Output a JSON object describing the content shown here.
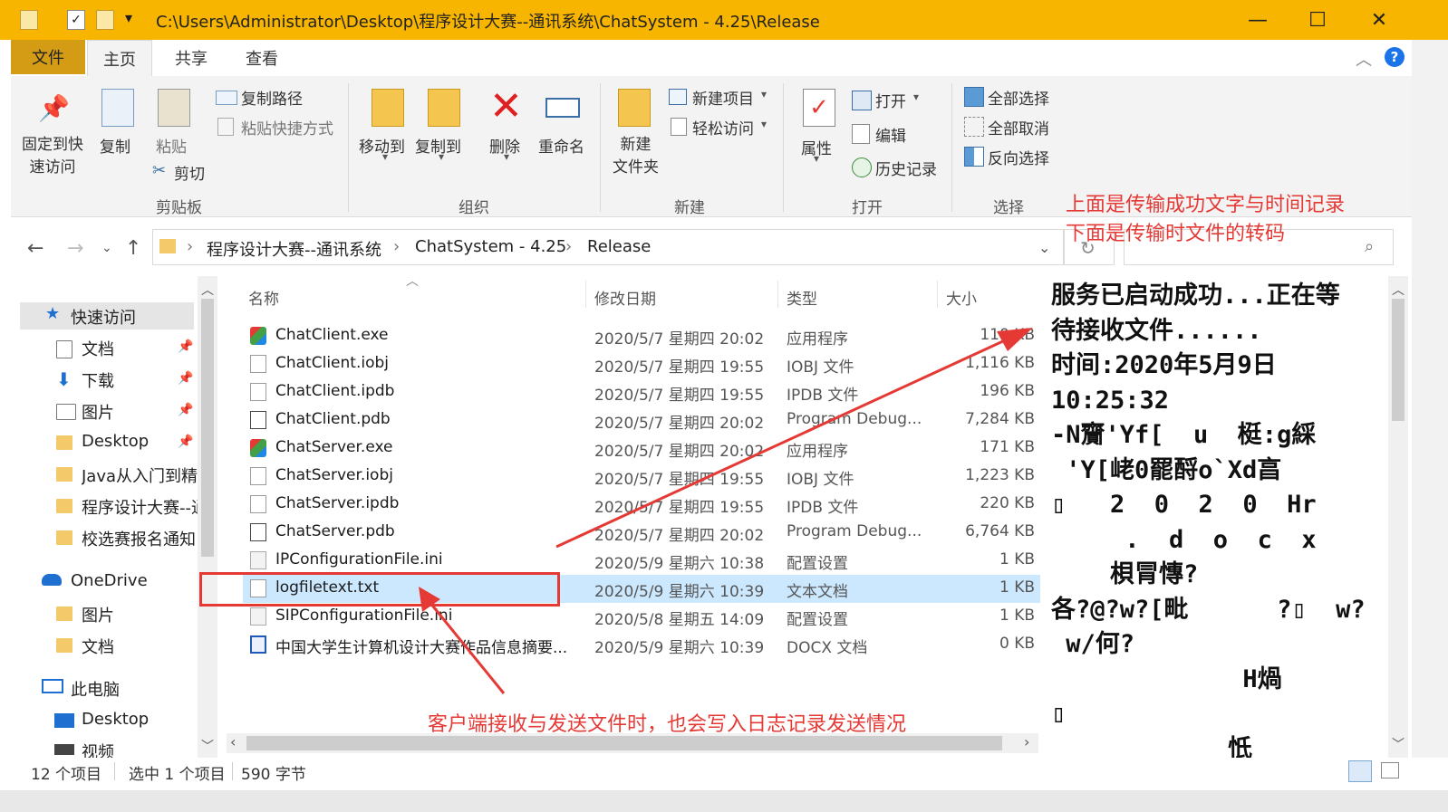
{
  "window": {
    "title": "C:\\Users\\Administrator\\Desktop\\程序设计大赛--通讯系统\\ChatSystem - 4.25\\Release",
    "controls": {
      "minimize": "—",
      "maximize": "☐",
      "close": "✕"
    }
  },
  "tabs": {
    "file": "文件",
    "home": "主页",
    "share": "共享",
    "view": "查看"
  },
  "ribbon": {
    "clipboard": {
      "pin": "固定到快\n速访问",
      "copy": "复制",
      "paste": "粘贴",
      "copy_path": "复制路径",
      "paste_shortcut": "粘贴快捷方式",
      "cut": "剪切",
      "group": "剪贴板"
    },
    "organize": {
      "move_to": "移动到",
      "copy_to": "复制到",
      "delete": "删除",
      "rename": "重命名",
      "group": "组织"
    },
    "new": {
      "new_folder": "新建\n文件夹",
      "new_item": "新建项目",
      "easy_access": "轻松访问",
      "group": "新建"
    },
    "open": {
      "properties": "属性",
      "open": "打开",
      "edit": "编辑",
      "history": "历史记录",
      "group": "打开"
    },
    "select": {
      "select_all": "全部选择",
      "select_none": "全部取消",
      "invert": "反向选择",
      "group": "选择"
    }
  },
  "address": {
    "crumbs": [
      "程序设计大赛--通讯系统",
      "ChatSystem - 4.25",
      "Release"
    ]
  },
  "navpane": {
    "quick_access": "快速访问",
    "items": [
      {
        "label": "文档",
        "pinned": true
      },
      {
        "label": "下载",
        "pinned": true
      },
      {
        "label": "图片",
        "pinned": true
      },
      {
        "label": "Desktop",
        "pinned": true
      },
      {
        "label": "Java从入门到精",
        "pinned": false
      },
      {
        "label": "程序设计大赛--通",
        "pinned": false
      },
      {
        "label": "校选赛报名通知",
        "pinned": false
      }
    ],
    "onedrive": "OneDrive",
    "onedrive_items": [
      "图片",
      "文档"
    ],
    "thispc": "此电脑",
    "thispc_items": [
      "Desktop",
      "视频"
    ]
  },
  "columns": {
    "name": "名称",
    "date": "修改日期",
    "type": "类型",
    "size": "大小"
  },
  "files": [
    {
      "name": "ChatClient.exe",
      "date": "2020/5/7 星期四 20:02",
      "type": "应用程序",
      "size": "110 KB",
      "icon": "exe"
    },
    {
      "name": "ChatClient.iobj",
      "date": "2020/5/7 星期四 19:55",
      "type": "IOBJ 文件",
      "size": "1,116 KB",
      "icon": "file"
    },
    {
      "name": "ChatClient.ipdb",
      "date": "2020/5/7 星期四 19:55",
      "type": "IPDB 文件",
      "size": "196 KB",
      "icon": "file"
    },
    {
      "name": "ChatClient.pdb",
      "date": "2020/5/7 星期四 20:02",
      "type": "Program Debug...",
      "size": "7,284 KB",
      "icon": "pdb"
    },
    {
      "name": "ChatServer.exe",
      "date": "2020/5/7 星期四 20:02",
      "type": "应用程序",
      "size": "171 KB",
      "icon": "exe"
    },
    {
      "name": "ChatServer.iobj",
      "date": "2020/5/7 星期四 19:55",
      "type": "IOBJ 文件",
      "size": "1,223 KB",
      "icon": "file"
    },
    {
      "name": "ChatServer.ipdb",
      "date": "2020/5/7 星期四 19:55",
      "type": "IPDB 文件",
      "size": "220 KB",
      "icon": "file"
    },
    {
      "name": "ChatServer.pdb",
      "date": "2020/5/7 星期四 20:02",
      "type": "Program Debug...",
      "size": "6,764 KB",
      "icon": "pdb"
    },
    {
      "name": "IPConfigurationFile.ini",
      "date": "2020/5/9 星期六 10:38",
      "type": "配置设置",
      "size": "1 KB",
      "icon": "ini"
    },
    {
      "name": "logfiletext.txt",
      "date": "2020/5/9 星期六 10:39",
      "type": "文本文档",
      "size": "1 KB",
      "icon": "txt",
      "selected": true
    },
    {
      "name": "SIPConfigurationFile.ini",
      "date": "2020/5/8 星期五 14:09",
      "type": "配置设置",
      "size": "1 KB",
      "icon": "ini"
    },
    {
      "name": "中国大学生计算机设计大赛作品信息摘要...",
      "date": "2020/5/9 星期六 10:39",
      "type": "DOCX 文档",
      "size": "0 KB",
      "icon": "docx"
    }
  ],
  "preview": {
    "lines": [
      "服务已启动成功...正在等",
      "待接收文件......",
      "时间:2020年5月9日",
      "10:25:32",
      "-N齎'Yf[  u  梃:g綵",
      " 'Y[峔0罷酹o`Xd亯",
      "▯   2  0  2  0  Hr",
      "     .  d  o  c  x",
      "    梖冐慱?",
      "各?@?w?[毗      ?▯  w?",
      " w/何?",
      "             H煱",
      "▯",
      "            忯"
    ]
  },
  "status": {
    "count": "12 个项目",
    "selected": "选中 1 个项目",
    "bytes": "590 字节"
  },
  "annotations": {
    "top_line1": "上面是传输成功文字与时间记录",
    "top_line2": "下面是传输时文件的转码",
    "bottom": "客户端接收与发送文件时，也会写入日志记录发送情况",
    "color": "#e53935"
  },
  "colors": {
    "titlebar": "#f7b500",
    "file_tab": "#d49b14",
    "selection": "#cce8ff"
  }
}
